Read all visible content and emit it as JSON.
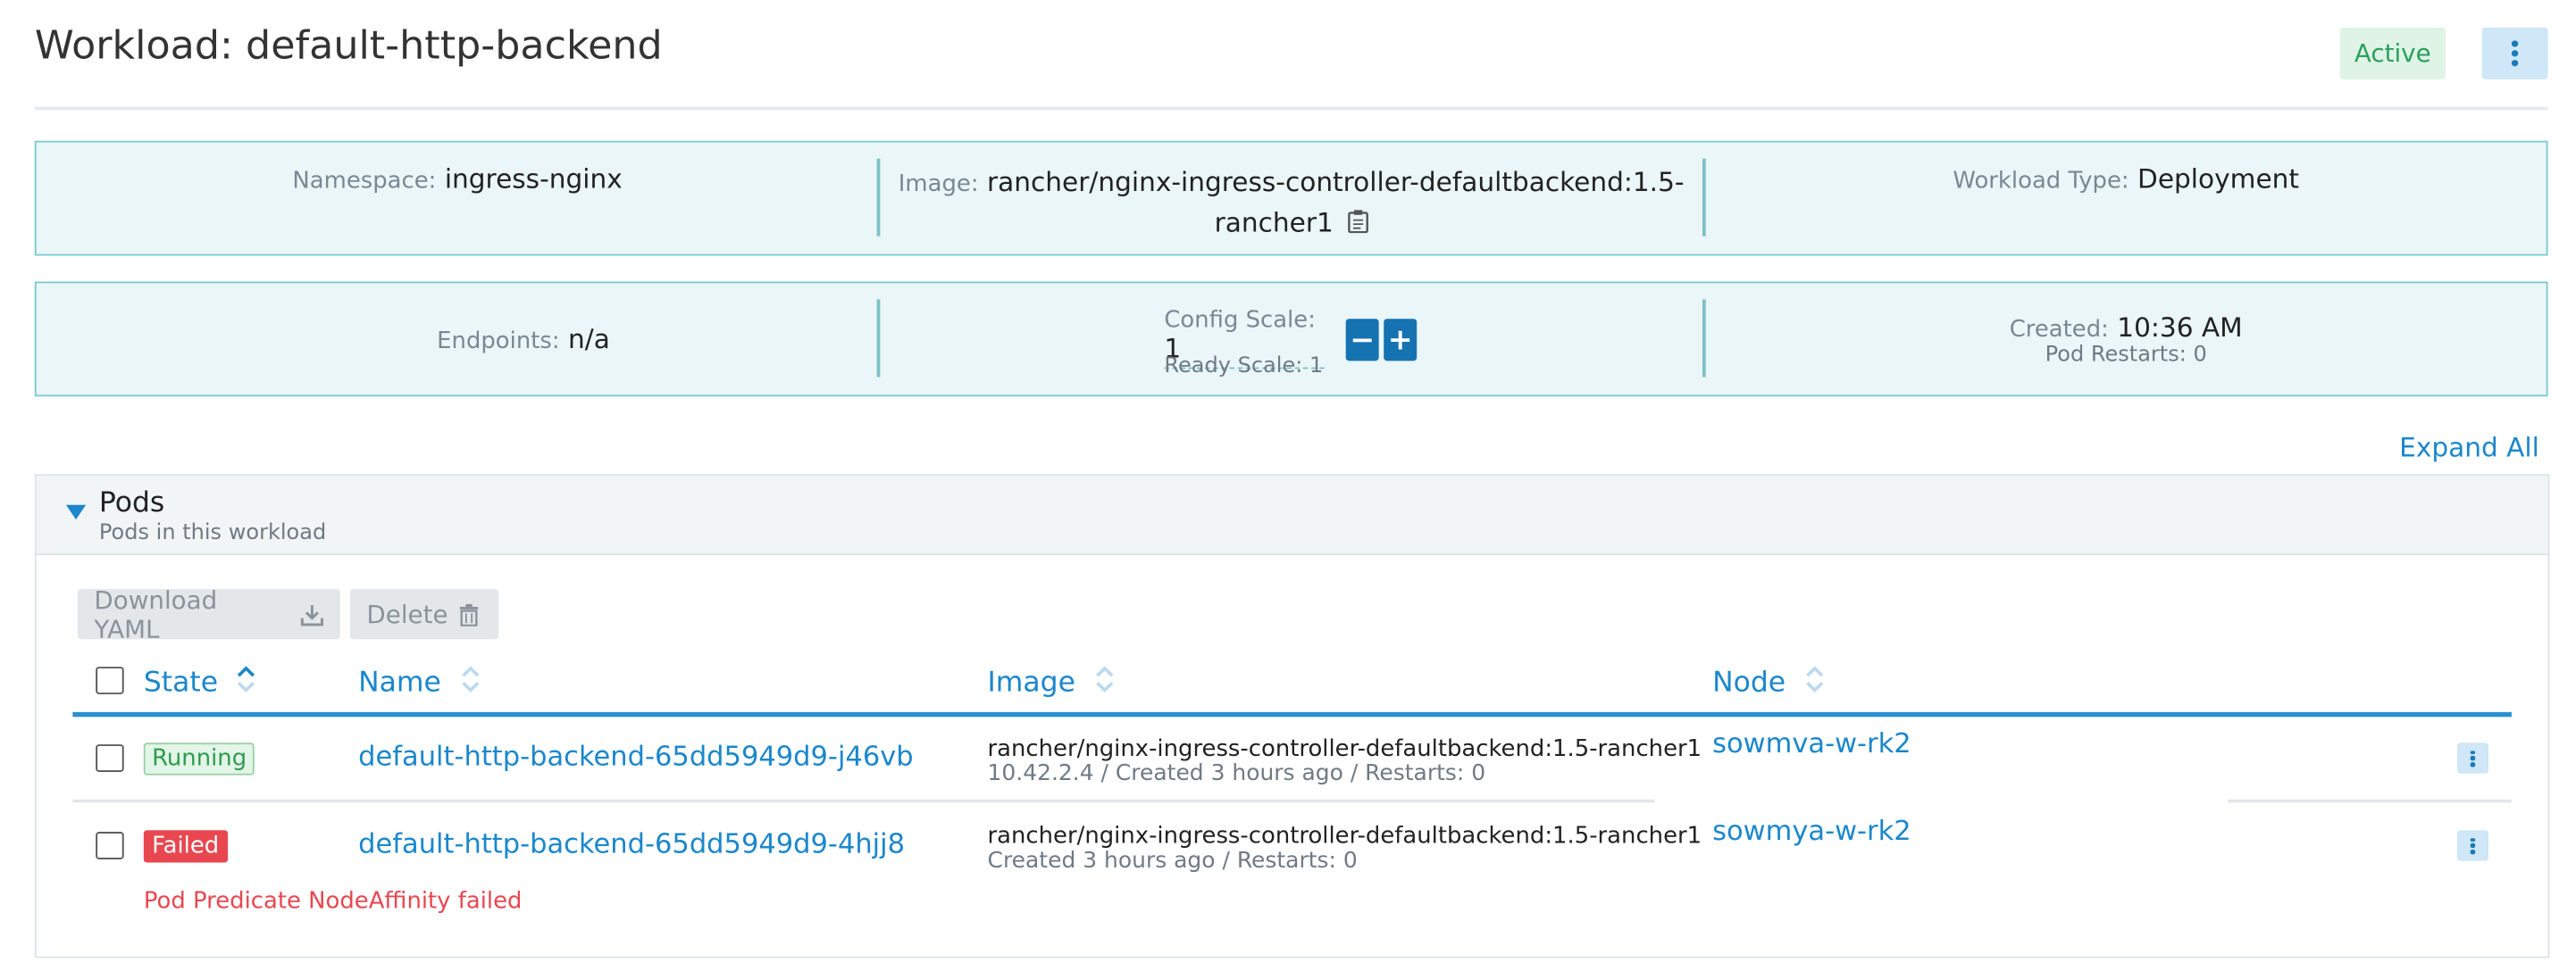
{
  "header": {
    "title": "Workload: default-http-backend",
    "status": "Active"
  },
  "info": {
    "namespace": {
      "label": "Namespace:",
      "value": "ingress-nginx"
    },
    "image": {
      "label": "Image:",
      "value_line1": "rancher/nginx-ingress-controller-defaultbackend:1.5-",
      "value_line2": "rancher1"
    },
    "workload_type": {
      "label": "Workload Type:",
      "value": "Deployment"
    },
    "endpoints": {
      "label": "Endpoints:",
      "value": "n/a"
    },
    "config_scale": {
      "label": "Config Scale:",
      "value": "1"
    },
    "ready_scale": "Ready Scale: 1",
    "scale_minus": "−",
    "scale_plus": "+",
    "created": {
      "label": "Created:",
      "value": "10:36 AM"
    },
    "pod_restarts": "Pod Restarts: 0"
  },
  "expand_all": "Expand All",
  "pods": {
    "title": "Pods",
    "subtitle": "Pods in this workload",
    "buttons": {
      "download_yaml": "Download YAML",
      "delete": "Delete"
    },
    "columns": {
      "state": "State",
      "name": "Name",
      "image": "Image",
      "node": "Node"
    },
    "rows": [
      {
        "state": "Running",
        "name": "default-http-backend-65dd5949d9-j46vb",
        "image": "rancher/nginx-ingress-controller-defaultbackend:1.5-rancher1",
        "detail": "10.42.2.4 / Created 3 hours ago / Restarts: 0",
        "node": "sowmva-w-rk2"
      },
      {
        "state": "Failed",
        "name": "default-http-backend-65dd5949d9-4hjj8",
        "image": "rancher/nginx-ingress-controller-defaultbackend:1.5-rancher1",
        "detail": "Created 3 hours ago / Restarts: 0",
        "node": "sowmya-w-rk2",
        "error": "Pod Predicate NodeAffinity failed"
      }
    ]
  },
  "colors": {
    "accent": "#1b87cc",
    "info_bg": "#eaf6f7",
    "active_green": "#2aa15b",
    "failed_red": "#e8474f"
  }
}
